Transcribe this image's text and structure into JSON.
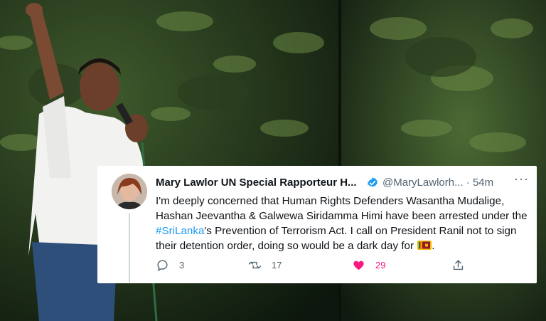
{
  "tweet": {
    "name": "Mary Lawlor UN Special Rapporteur H...",
    "handle": "@MaryLawlorh...",
    "time": "54m",
    "more": "···",
    "text_before": "I'm deeply concerned that Human Rights Defenders Wasantha Mudalige, Hashan Jeevantha & Galwewa Siridamma Himi have been arrested under the ",
    "hashtag": "#SriLanka",
    "text_after": "'s Prevention of Terrorism Act. I call on President Ranil not to sign their detention order, doing so would be a dark day for ",
    "text_end": ".",
    "reply_count": "3",
    "retweet_count": "17",
    "like_count": "29",
    "share_label": ""
  },
  "colors": {
    "verified": "#1d9bf0",
    "hashtag": "#1d9bf0",
    "like": "#f91880",
    "muted": "#536471"
  },
  "icons": [
    "avatar",
    "verified-badge-icon",
    "more-icon",
    "sri-lanka-flag-icon",
    "reply-icon",
    "retweet-icon",
    "like-heart-icon",
    "share-icon"
  ]
}
